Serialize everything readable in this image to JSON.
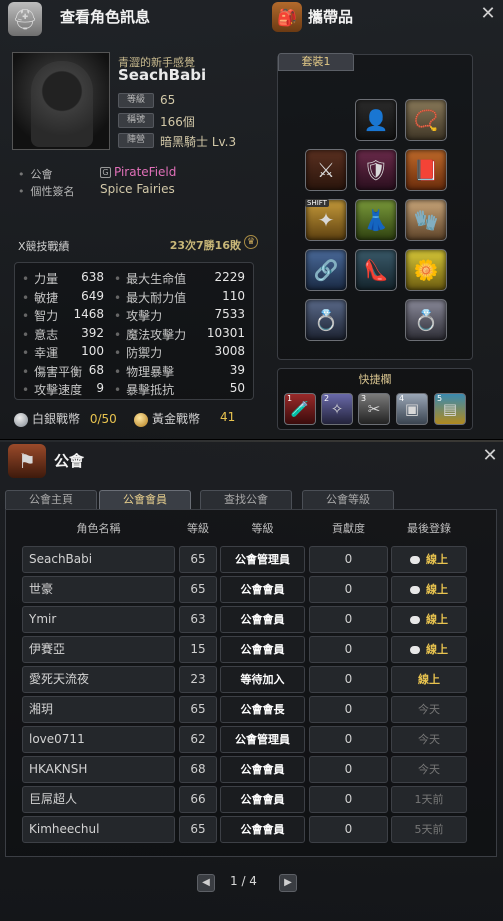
{
  "character_window": {
    "title": "查看角色訊息",
    "inventory_title": "攜帶品",
    "subtitle": "青澀的新手感覺",
    "name": "SeachBabi",
    "tags": [
      {
        "label": "等級",
        "value": "65"
      },
      {
        "label": "稱號",
        "value": "166個"
      },
      {
        "label": "陣營",
        "value": "暗黑騎士 Lv.3"
      }
    ],
    "guild_label": "公會",
    "guild_value": "PirateField",
    "guild_badge": "G",
    "signature_label": "個性簽名",
    "signature_value": "Spice Fairies",
    "x_skill_label": "X競技戰績",
    "x_skill_record": "23次7勝16敗",
    "stats_left": [
      {
        "label": "力量",
        "value": "638"
      },
      {
        "label": "敏捷",
        "value": "649"
      },
      {
        "label": "智力",
        "value": "1468"
      },
      {
        "label": "意志",
        "value": "392"
      },
      {
        "label": "幸運",
        "value": "100"
      },
      {
        "label": "傷害平衡",
        "value": "68"
      },
      {
        "label": "攻擊速度",
        "value": "9"
      }
    ],
    "stats_right": [
      {
        "label": "最大生命值",
        "value": "2229"
      },
      {
        "label": "最大耐力值",
        "value": "110"
      },
      {
        "label": "攻擊力",
        "value": "7533"
      },
      {
        "label": "魔法攻擊力",
        "value": "10301"
      },
      {
        "label": "防禦力",
        "value": "3008"
      },
      {
        "label": "物理暴擊",
        "value": "39"
      },
      {
        "label": "暴擊抵抗",
        "value": "50"
      }
    ],
    "silver_label": "白銀戰幣",
    "silver_value": "0/50",
    "gold_label": "黃金戰幣",
    "gold_value": "41",
    "equip_tab": "套裝1",
    "shift_label": "SHIFT",
    "quick_title": "快捷欄"
  },
  "guild_window": {
    "title": "公會",
    "tabs": [
      "公會主頁",
      "公會會員",
      "查找公會",
      "公會等級"
    ],
    "active_tab": 1,
    "columns": [
      "角色名稱",
      "等級",
      "等級",
      "貢獻度",
      "最後登錄"
    ],
    "members": [
      {
        "name": "SeachBabi",
        "level": "65",
        "rank": "公會管理員",
        "contribution": "0",
        "last": "線上",
        "chat": true
      },
      {
        "name": "世豪",
        "level": "65",
        "rank": "公會會員",
        "contribution": "0",
        "last": "線上",
        "chat": true
      },
      {
        "name": "Ymir",
        "level": "63",
        "rank": "公會會員",
        "contribution": "0",
        "last": "線上",
        "chat": true
      },
      {
        "name": "伊賽亞",
        "level": "15",
        "rank": "公會會員",
        "contribution": "0",
        "last": "線上",
        "chat": true
      },
      {
        "name": "愛死天流夜",
        "level": "23",
        "rank": "等待加入",
        "contribution": "0",
        "last": "線上",
        "chat": false
      },
      {
        "name": "湘玥",
        "level": "65",
        "rank": "公會會長",
        "contribution": "0",
        "last": "今天",
        "chat": false
      },
      {
        "name": "love0711",
        "level": "62",
        "rank": "公會管理員",
        "contribution": "0",
        "last": "今天",
        "chat": false
      },
      {
        "name": "HKAKNSH",
        "level": "68",
        "rank": "公會會員",
        "contribution": "0",
        "last": "今天",
        "chat": false
      },
      {
        "name": "巨屌超人",
        "level": "66",
        "rank": "公會會員",
        "contribution": "0",
        "last": "1天前",
        "chat": false
      },
      {
        "name": "Kimheechul",
        "level": "65",
        "rank": "公會會員",
        "contribution": "0",
        "last": "5天前",
        "chat": false
      }
    ],
    "pager": "1 / 4"
  },
  "colors": {
    "accent_gold": "#e8c34f",
    "online": "#e8c34f",
    "offline": "#777777",
    "guild_name": "#e070b8"
  }
}
